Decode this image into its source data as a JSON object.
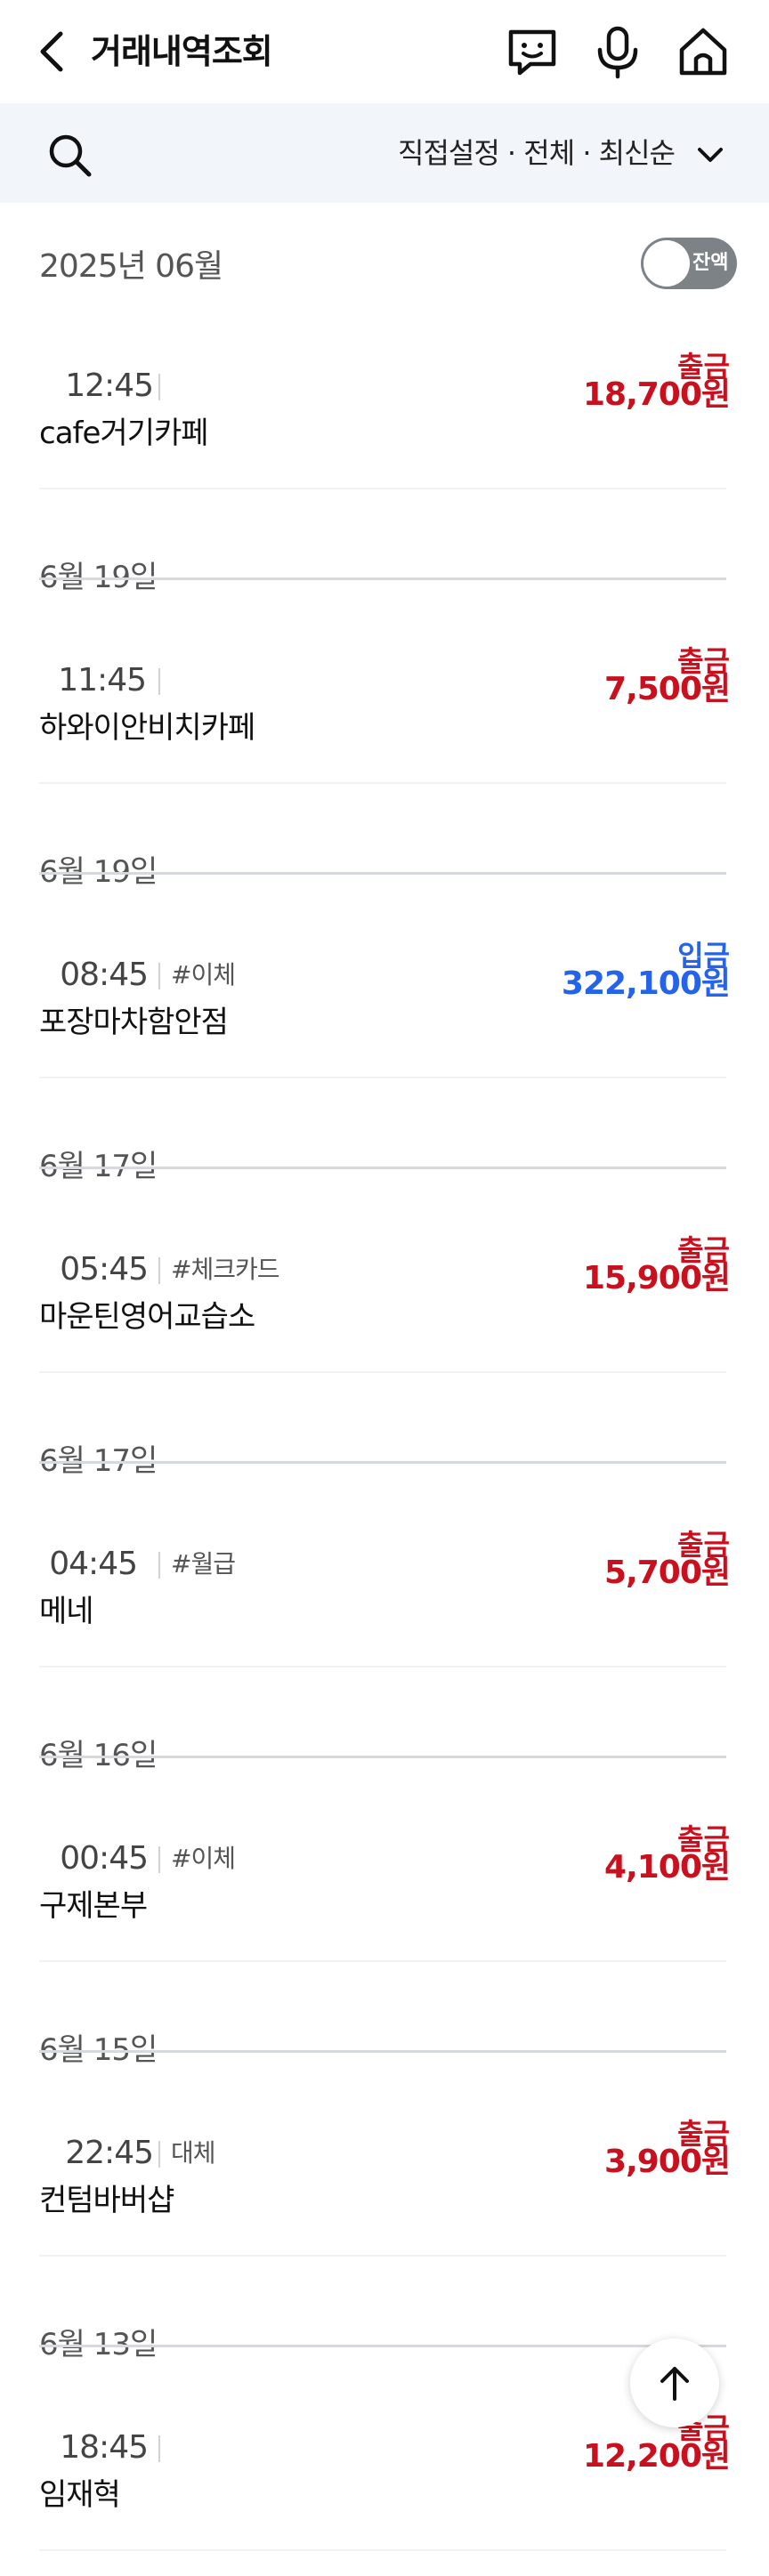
{
  "header": {
    "title": "거래내역조회",
    "icons": [
      "back-icon",
      "chatbot-icon",
      "microphone-icon",
      "home-icon"
    ]
  },
  "filter": {
    "text": "직접설정 · 전체 · 최신순"
  },
  "month_label": "2025년 06월",
  "balance_toggle": {
    "label": "잔액",
    "on": false
  },
  "transactions": [
    {
      "date": "",
      "time": "12:45",
      "tag": "",
      "name": "cafe거기카페",
      "kind": "출금",
      "amount": "18,700원",
      "type": "out"
    },
    {
      "date": "6월 19일",
      "time": "11:45",
      "tag": "",
      "name": "하와이안비치카페",
      "kind": "출금",
      "amount": "7,500원",
      "type": "out"
    },
    {
      "date": "6월 19일",
      "time": "08:45",
      "tag": "#이체",
      "name": "포장마차함안점",
      "kind": "입금",
      "amount": "322,100원",
      "type": "in"
    },
    {
      "date": "6월 17일",
      "time": "05:45",
      "tag": "#체크카드",
      "name": "마운틴영어교습소",
      "kind": "출금",
      "amount": "15,900원",
      "type": "out"
    },
    {
      "date": "6월 17일",
      "time": "04:45",
      "tag": "#월급",
      "name": "메네",
      "kind": "출금",
      "amount": "5,700원",
      "type": "out"
    },
    {
      "date": "6월 16일",
      "time": "00:45",
      "tag": "#이체",
      "name": "구제본부",
      "kind": "출금",
      "amount": "4,100원",
      "type": "out"
    },
    {
      "date": "6월 15일",
      "time": "22:45",
      "tag": "대체",
      "name": "컨텀바버샵",
      "kind": "출금",
      "amount": "3,900원",
      "type": "out"
    },
    {
      "date": "6월 13일",
      "time": "18:45",
      "tag": "",
      "name": "임재혁",
      "kind": "출금",
      "amount": "12,200원",
      "type": "out"
    }
  ],
  "colors": {
    "out": "#c8101e",
    "in": "#2563eb"
  },
  "scroll_top_icon": "arrow-up-icon"
}
